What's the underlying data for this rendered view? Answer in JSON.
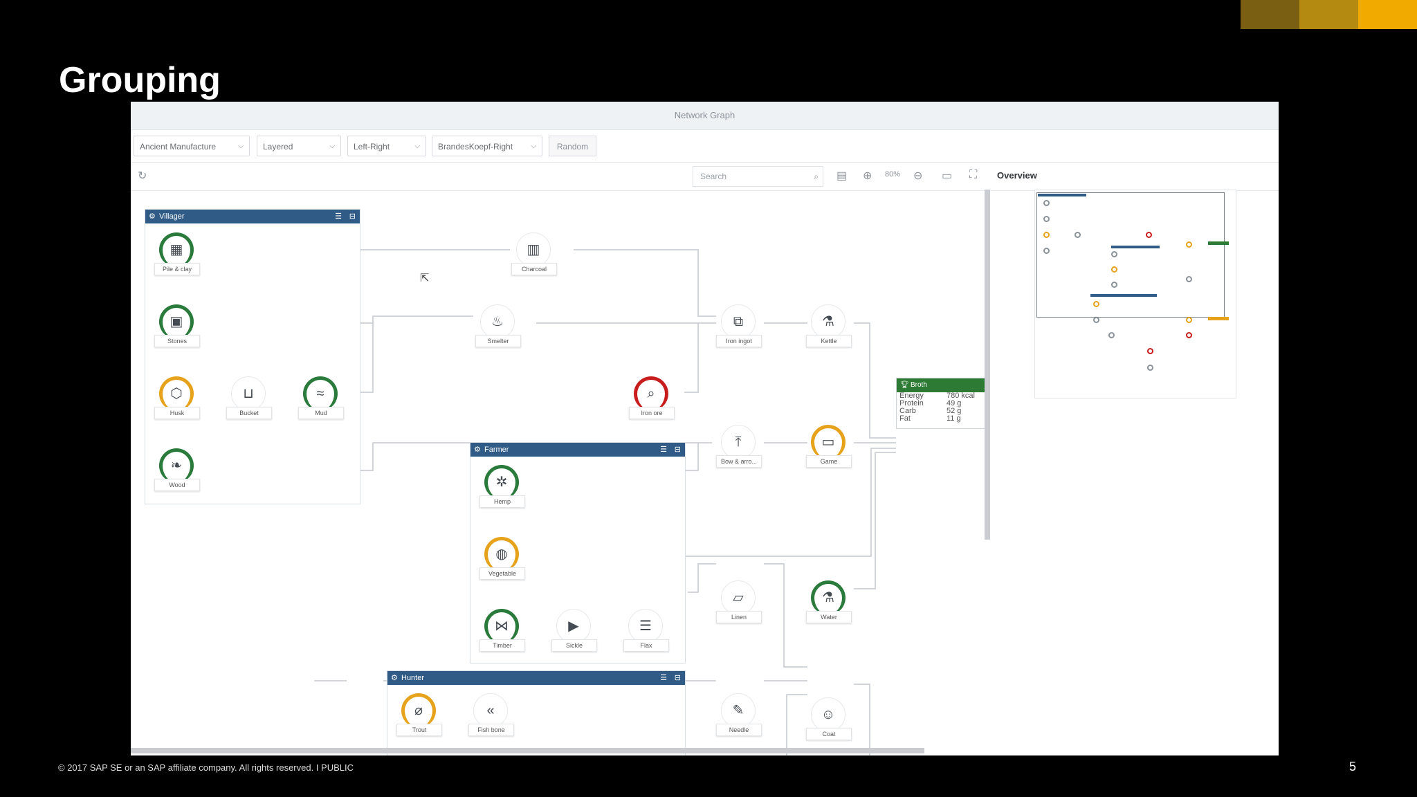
{
  "slide": {
    "title": "Grouping",
    "footer": "© 2017 SAP SE or an SAP affiliate company. All rights reserved.   I   PUBLIC",
    "page_number": "5",
    "brand_colors": [
      "#7a5e12",
      "#b58a10",
      "#f0aa00"
    ]
  },
  "app": {
    "window_title": "Network Graph",
    "toolbar": {
      "selects": [
        {
          "id": "dataset",
          "value": "Ancient Manufacture"
        },
        {
          "id": "layout",
          "value": "Layered"
        },
        {
          "id": "orientation",
          "value": "Left-Right"
        },
        {
          "id": "alignment",
          "value": "BrandesKoepf-Right"
        }
      ],
      "random_label": "Random",
      "search_placeholder": "Search",
      "zoom_level": "80%",
      "overview_label": "Overview"
    },
    "groups": [
      {
        "id": "villager",
        "title": "Villager",
        "nodes": [
          "Pile & clay",
          "Stones",
          "Husk",
          "Bucket",
          "Mud",
          "Wood"
        ]
      },
      {
        "id": "farmer",
        "title": "Farmer",
        "nodes": [
          "Hemp",
          "Vegetable",
          "Timber",
          "Sickle",
          "Flax"
        ]
      },
      {
        "id": "hunter",
        "title": "Hunter",
        "nodes": [
          "Trout",
          "Fish bone"
        ]
      }
    ],
    "nodes": {
      "pile_clay": "Pile & clay",
      "stones": "Stones",
      "husk": "Husk",
      "bucket": "Bucket",
      "mud": "Mud",
      "wood": "Wood",
      "charcoal": "Charcoal",
      "smelter": "Smelter",
      "iron_ore": "Iron ore",
      "iron_ingot": "Iron ingot",
      "kettle": "Kettle",
      "bow_arrow": "Bow & arro...",
      "game": "Game",
      "hemp": "Hemp",
      "vegetable": "Vegetable",
      "timber": "Timber",
      "sickle": "Sickle",
      "flax": "Flax",
      "linen": "Linen",
      "water": "Water",
      "trout": "Trout",
      "fish_bone": "Fish bone",
      "needle": "Needle",
      "coat": "Coat"
    },
    "result_node": {
      "title": "Broth",
      "rows": [
        {
          "label": "Energy",
          "value": "780 kcal"
        },
        {
          "label": "Protein",
          "value": "49 g"
        },
        {
          "label": "Carb",
          "value": "52 g"
        },
        {
          "label": "Fat",
          "value": "11 g"
        }
      ]
    },
    "status_colors": {
      "good": "#2a7a3b",
      "warning": "#e7a21c",
      "critical": "#c81d1d",
      "group_header": "#2f5b86",
      "result_header": "#2d7a34"
    }
  }
}
